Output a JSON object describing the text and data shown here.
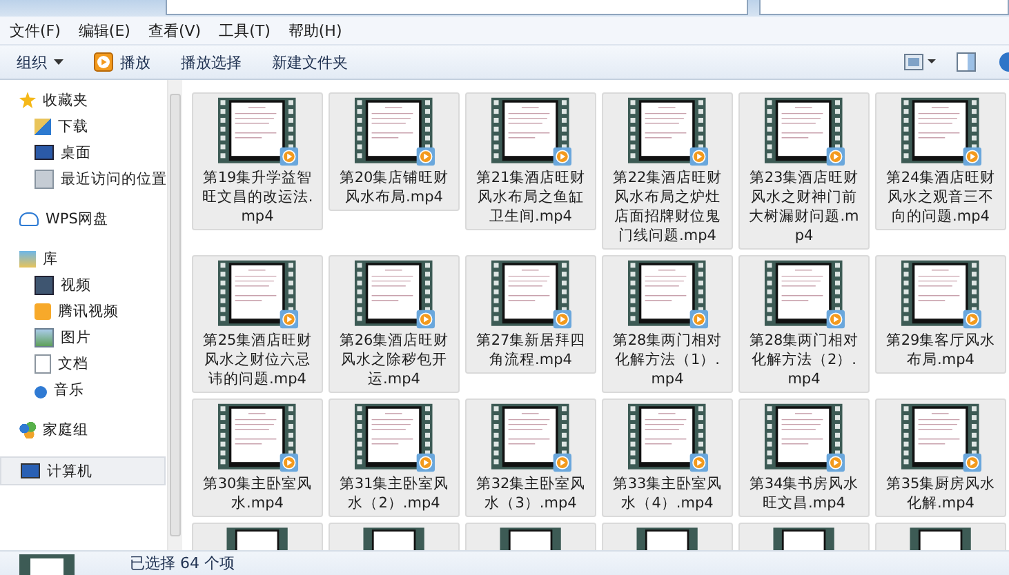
{
  "menu": [
    "文件(F)",
    "编辑(E)",
    "查看(V)",
    "工具(T)",
    "帮助(H)"
  ],
  "toolbar": [
    {
      "label": "组织",
      "kind": "dropdown"
    },
    {
      "label": "播放",
      "kind": "play"
    },
    {
      "label": "播放选择",
      "kind": "plain"
    },
    {
      "label": "新建文件夹",
      "kind": "plain"
    }
  ],
  "sidebar": [
    {
      "label": "收藏夹",
      "kind": "star",
      "selected": false,
      "children": [
        {
          "label": "下载",
          "kind": "download",
          "selected": false
        },
        {
          "label": "桌面",
          "kind": "desktop",
          "selected": false
        },
        {
          "label": "最近访问的位置",
          "kind": "recent",
          "selected": false
        }
      ]
    },
    {
      "label": "WPS网盘",
      "kind": "cloud",
      "selected": false
    },
    {
      "label": "库",
      "kind": "library",
      "selected": false,
      "children": [
        {
          "label": "视频",
          "kind": "video",
          "selected": false
        },
        {
          "label": "腾讯视频",
          "kind": "tvideo",
          "selected": false
        },
        {
          "label": "图片",
          "kind": "picture",
          "selected": false
        },
        {
          "label": "文档",
          "kind": "document",
          "selected": false
        },
        {
          "label": "音乐",
          "kind": "music",
          "selected": false
        }
      ]
    },
    {
      "label": "家庭组",
      "kind": "homegroup",
      "selected": false
    },
    {
      "label": "计算机",
      "kind": "computer",
      "selected": true
    }
  ],
  "files": [
    {
      "name": "第19集升学益智旺文昌的改运法.mp4",
      "selected": true
    },
    {
      "name": "第20集店铺旺财风水布局.mp4",
      "selected": true
    },
    {
      "name": "第21集酒店旺财风水布局之鱼缸卫生间.mp4",
      "selected": true
    },
    {
      "name": "第22集酒店旺财风水布局之炉灶店面招牌财位鬼门线问题.mp4",
      "selected": true
    },
    {
      "name": "第23集酒店旺财风水之财神门前大树漏财问题.mp4",
      "selected": true
    },
    {
      "name": "第24集酒店旺财风水之观音三不向的问题.mp4",
      "selected": true
    },
    {
      "name": "第25集酒店旺财风水之财位六忌讳的问题.mp4",
      "selected": true
    },
    {
      "name": "第26集酒店旺财风水之除秽包开运.mp4",
      "selected": true
    },
    {
      "name": "第27集新居拜四角流程.mp4",
      "selected": true
    },
    {
      "name": "第28集两门相对化解方法（1）.mp4",
      "selected": true
    },
    {
      "name": "第28集两门相对化解方法（2）.mp4",
      "selected": true
    },
    {
      "name": "第29集客厅风水布局.mp4",
      "selected": true
    },
    {
      "name": "第30集主卧室风水.mp4",
      "selected": true
    },
    {
      "name": "第31集主卧室风水（2）.mp4",
      "selected": true
    },
    {
      "name": "第32集主卧室风水（3）.mp4",
      "selected": true
    },
    {
      "name": "第33集主卧室风水（4）.mp4",
      "selected": true
    },
    {
      "name": "第34集书房风水旺文昌.mp4",
      "selected": true
    },
    {
      "name": "第35集厨房风水化解.mp4",
      "selected": true
    }
  ],
  "status": "已选择 64 个项"
}
